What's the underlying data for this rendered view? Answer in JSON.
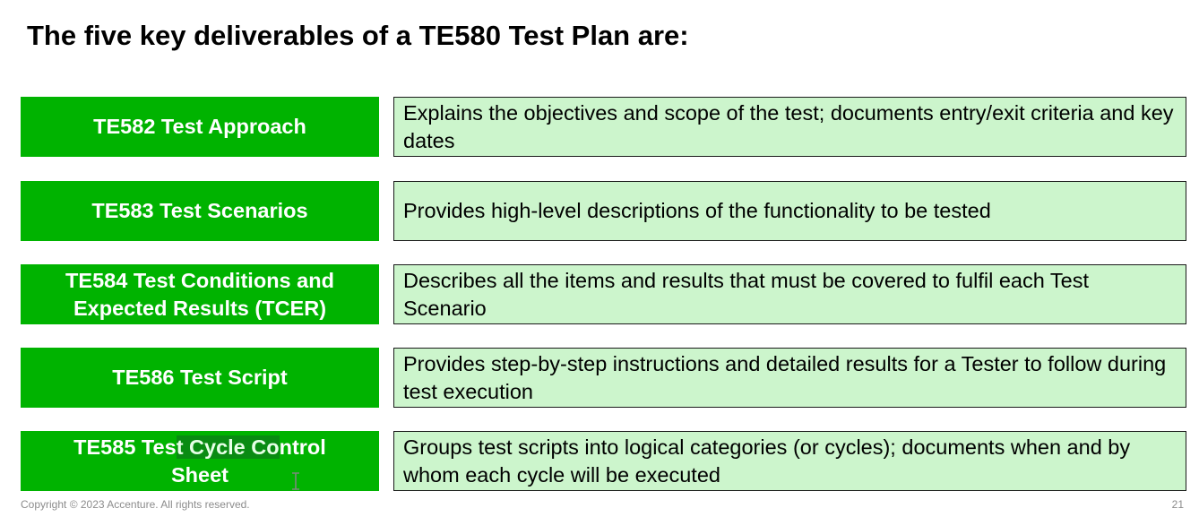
{
  "slide": {
    "title": "The five key deliverables of a TE580 Test Plan are:",
    "label_color": "#00b300",
    "desc_color": "#ccf5cc"
  },
  "deliverables": [
    {
      "name": "TE582 Test Approach",
      "description": "Explains the objectives and scope of the test; documents entry/exit criteria and key dates"
    },
    {
      "name": "TE583 Test Scenarios",
      "description": "Provides high-level descriptions of the functionality to be tested"
    },
    {
      "name": "TE584 Test Conditions and Expected Results (TCER)",
      "description": "Describes all the items and results that must be covered to fulfil each Test Scenario"
    },
    {
      "name": "TE586 Test Script",
      "description": "Provides step-by-step instructions and detailed results for a Tester to follow during test execution"
    },
    {
      "name_parts": [
        "TE585 Tes",
        "t Cycle Co",
        "ntrol Sheet"
      ],
      "description": "Groups test scripts into logical categories (or cycles); documents when and by whom each cycle will be executed"
    }
  ],
  "footer": {
    "copyright": "Copyright © 2023 Accenture. All rights reserved.",
    "page_number": "21"
  },
  "icons": {
    "cursor": "text-cursor-icon"
  }
}
